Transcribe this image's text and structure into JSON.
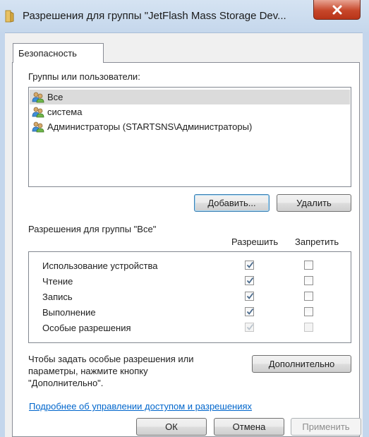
{
  "window": {
    "title": "Разрешения для группы \"JetFlash Mass Storage Dev..."
  },
  "tabs": [
    {
      "label": "Безопасность",
      "selected": true
    }
  ],
  "groups_section": {
    "label": "Группы или пользователи:",
    "items": [
      {
        "label": "Все",
        "selected": true,
        "icon": "group-icon"
      },
      {
        "label": "система",
        "selected": false,
        "icon": "group-icon"
      },
      {
        "label": "Администраторы (STARTSNS\\Администраторы)",
        "selected": false,
        "icon": "group-icon"
      }
    ],
    "add_button": "Добавить...",
    "remove_button": "Удалить"
  },
  "permissions": {
    "label": "Разрешения для группы \"Все\"",
    "col_allow": "Разрешить",
    "col_deny": "Запретить",
    "rows": [
      {
        "name": "Использование устройства",
        "allow": true,
        "deny": false,
        "disabled": false
      },
      {
        "name": "Чтение",
        "allow": true,
        "deny": false,
        "disabled": false
      },
      {
        "name": "Запись",
        "allow": true,
        "deny": false,
        "disabled": false
      },
      {
        "name": "Выполнение",
        "allow": true,
        "deny": false,
        "disabled": false
      },
      {
        "name": "Особые разрешения",
        "allow": true,
        "deny": false,
        "disabled": true
      }
    ]
  },
  "advanced": {
    "text_line1": "Чтобы задать особые разрешения или",
    "text_line2": "параметры, нажмите кнопку",
    "text_line3": "\"Дополнительно\".",
    "button": "Дополнительно"
  },
  "link": "Подробнее об управлении доступом и разрешениях",
  "footer": {
    "ok": "ОК",
    "cancel": "Отмена",
    "apply": "Применить"
  },
  "colors": {
    "link": "#0066cc",
    "selection": "#dbdbdb",
    "close_button": "#c7472a"
  }
}
